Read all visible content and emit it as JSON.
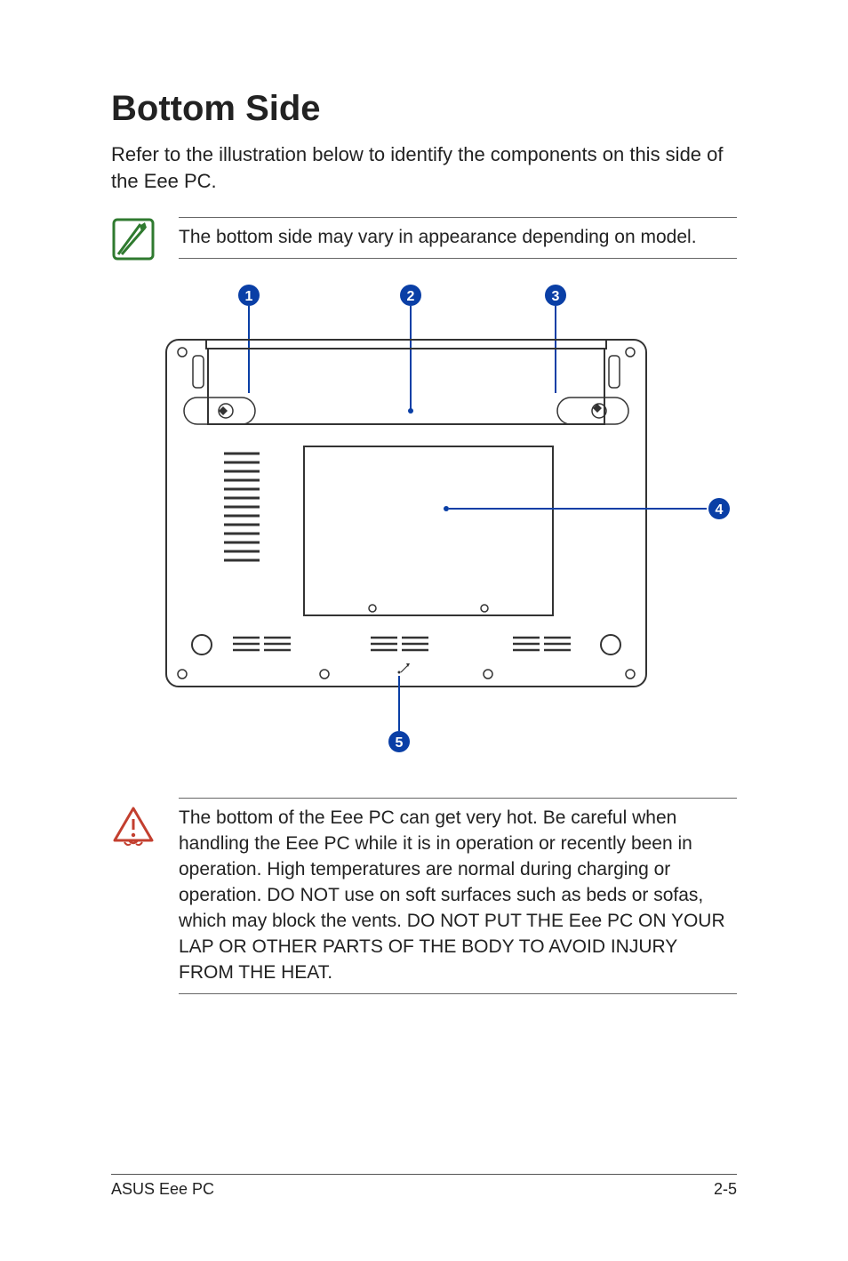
{
  "heading": "Bottom Side",
  "intro": "Refer to the illustration below to identify the components on this side of the Eee PC.",
  "note": "The bottom side may vary in appearance depending on model.",
  "warning": "The bottom of the Eee PC can get very hot. Be careful when handling the Eee PC while it is in operation or recently been in operation. High temperatures are normal during charging or operation. DO NOT use on soft surfaces such as beds or sofas, which may block the vents. DO NOT PUT THE Eee PC ON YOUR LAP OR OTHER PARTS OF THE BODY TO AVOID INJURY FROM THE HEAT.",
  "callouts": {
    "c1": "1",
    "c2": "2",
    "c3": "3",
    "c4": "4",
    "c5": "5"
  },
  "footer": {
    "left": "ASUS Eee PC",
    "right": "2-5"
  },
  "colors": {
    "accent": "#0a3fa6",
    "warn": "#c33f2f",
    "note": "#2f7a2f"
  }
}
